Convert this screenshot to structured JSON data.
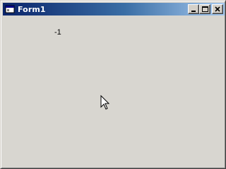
{
  "window": {
    "title": "Form1",
    "icon": "form-window-icon",
    "controls": [
      "minimize-icon",
      "maximize-icon",
      "close-icon"
    ]
  },
  "form": {
    "label_text": "-1"
  },
  "colors": {
    "titlebar_start": "#0a246a",
    "titlebar_end": "#a6caf0",
    "face": "#d4d0c8",
    "client": "#d8d6d0"
  }
}
